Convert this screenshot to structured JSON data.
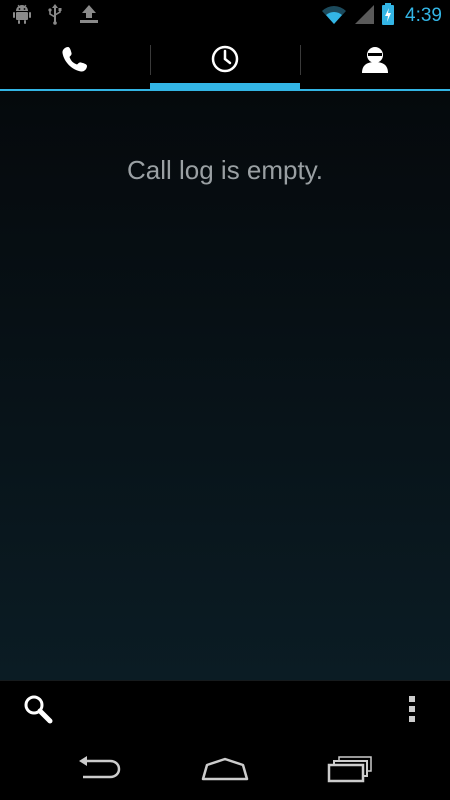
{
  "status_bar": {
    "time": "4:39",
    "icons_left": [
      "android-icon",
      "usb-icon",
      "upload-icon"
    ],
    "icons_right": [
      "wifi-icon",
      "signal-icon",
      "battery-charging-icon"
    ],
    "accent_color": "#33b5e5"
  },
  "tabs": [
    {
      "name": "phone",
      "icon": "phone-icon",
      "selected": false
    },
    {
      "name": "call-log",
      "icon": "clock-icon",
      "selected": true
    },
    {
      "name": "contacts",
      "icon": "person-icon",
      "selected": false
    }
  ],
  "main": {
    "empty_message": "Call log is empty."
  },
  "action_bar": {
    "icons": [
      "search-icon",
      "overflow-menu-icon"
    ]
  },
  "nav_bar": {
    "icons": [
      "back-icon",
      "home-icon",
      "recent-apps-icon"
    ]
  },
  "colors": {
    "accent": "#33b5e5",
    "background_top": "#05090c",
    "background_bottom": "#0b1c24",
    "empty_text": "#9aa0a3"
  }
}
